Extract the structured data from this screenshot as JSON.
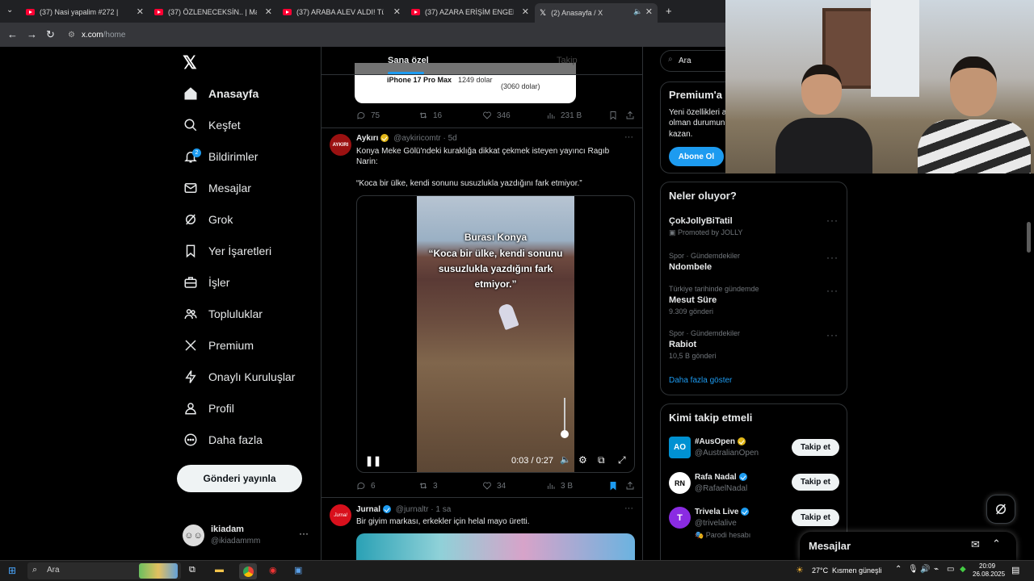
{
  "browser": {
    "tabs": [
      {
        "label": "(37) Nasi yapalim #272 | Karşılı"
      },
      {
        "label": "(37) ÖZLENECEKSİN.. | Madara"
      },
      {
        "label": "(37) ARABA ALEV ALDI! Türkiye"
      },
      {
        "label": "(37) AZARA ERİŞİM ENGELİ GET"
      },
      {
        "label": "(2) Anasayfa / X"
      }
    ],
    "url_host": "x.com",
    "url_path": "/home"
  },
  "sidebar": {
    "items": [
      {
        "label": "Anasayfa",
        "icon": "home-icon"
      },
      {
        "label": "Keşfet",
        "icon": "search-icon"
      },
      {
        "label": "Bildirimler",
        "icon": "bell-icon",
        "badge": "2"
      },
      {
        "label": "Mesajlar",
        "icon": "mail-icon"
      },
      {
        "label": "Grok",
        "icon": "grok-icon"
      },
      {
        "label": "Yer İşaretleri",
        "icon": "bookmark-icon"
      },
      {
        "label": "İşler",
        "icon": "briefcase-icon"
      },
      {
        "label": "Topluluklar",
        "icon": "people-icon"
      },
      {
        "label": "Premium",
        "icon": "x-logo-icon"
      },
      {
        "label": "Onaylı Kuruluşlar",
        "icon": "bolt-icon"
      },
      {
        "label": "Profil",
        "icon": "person-icon"
      },
      {
        "label": "Daha fazla",
        "icon": "more-circle-icon"
      }
    ],
    "post_button": "Gönderi yayınla",
    "account": {
      "name": "ikiadam",
      "handle": "@ikiadammm"
    }
  },
  "feed": {
    "tabs": {
      "for_you": "Sana özel",
      "following": "Takip"
    },
    "prev_post": {
      "product": "iPhone 17 Pro Max",
      "price": "1249 dolar",
      "price2": "(3060 dolar)",
      "replies": "75",
      "reposts": "16",
      "likes": "346",
      "views": "231 B"
    },
    "post1": {
      "avatar_text": "AYKIRI",
      "name": "Aykırı",
      "handle": "@aykiricomtr",
      "time": "· 5d",
      "text1": "Konya Meke Gölü'ndeki kuraklığa dikkat çekmek isteyen yayıncı Ragıb Narin:",
      "text2": "“Koca bir ülke, kendi sonunu susuzlukla yazdığını fark etmiyor.”",
      "video_caption_1": "Burası Konya",
      "video_caption_2": "“Koca bir ülke, kendi sonunu susuzlukla yazdığını fark etmiyor.”",
      "video_time": "0:03 / 0:27",
      "replies": "6",
      "reposts": "3",
      "likes": "34",
      "views": "3 B"
    },
    "post2": {
      "avatar_text": "Jurnal",
      "name": "Jurnal",
      "handle": "@jurnaltr",
      "time": "· 1 sa",
      "text": "Bir giyim markası, erkekler için helal mayo üretti."
    }
  },
  "right": {
    "search_placeholder": "Ara",
    "premium": {
      "title": "Premium'a",
      "text1": "Yeni özellikleri a",
      "text2": "olman durumun",
      "text3": "kazan.",
      "button": "Abone Ol"
    },
    "trends": {
      "title": "Neler oluyor?",
      "items": [
        {
          "meta": "",
          "title": "ÇokJollyBiTatil",
          "sub": "Promoted by JOLLY"
        },
        {
          "meta": "Spor · Gündemdekiler",
          "title": "Ndombele",
          "sub": ""
        },
        {
          "meta": "Türkiye tarihinde gündemde",
          "title": "Mesut Süre",
          "sub": "9.309 gönderi"
        },
        {
          "meta": "Spor · Gündemdekiler",
          "title": "Rabiot",
          "sub": "10,5 B gönderi"
        }
      ],
      "more": "Daha fazla göster"
    },
    "who_to_follow": {
      "title": "Kimi takip etmeli",
      "items": [
        {
          "name": "#AusOpen",
          "handle": "@AustralianOpen",
          "button": "Takip et",
          "avatar": "AO",
          "extra": ""
        },
        {
          "name": "Rafa Nadal",
          "handle": "@RafaelNadal",
          "button": "Takip et",
          "avatar": "RN",
          "extra": ""
        },
        {
          "name": "Trivela Live",
          "handle": "@trivelalive",
          "button": "Takip et",
          "avatar": "T",
          "extra": "Parodi hesabı"
        }
      ]
    },
    "messages_drawer": "Mesajlar"
  },
  "taskbar": {
    "search": "Ara",
    "weather": "27°C",
    "weather_desc": "Kısmen güneşli",
    "time": "20:09",
    "date": "26.08.2025"
  },
  "colors": {
    "accent": "#1d9bf0",
    "bg": "#000000",
    "border": "#2f3336"
  }
}
